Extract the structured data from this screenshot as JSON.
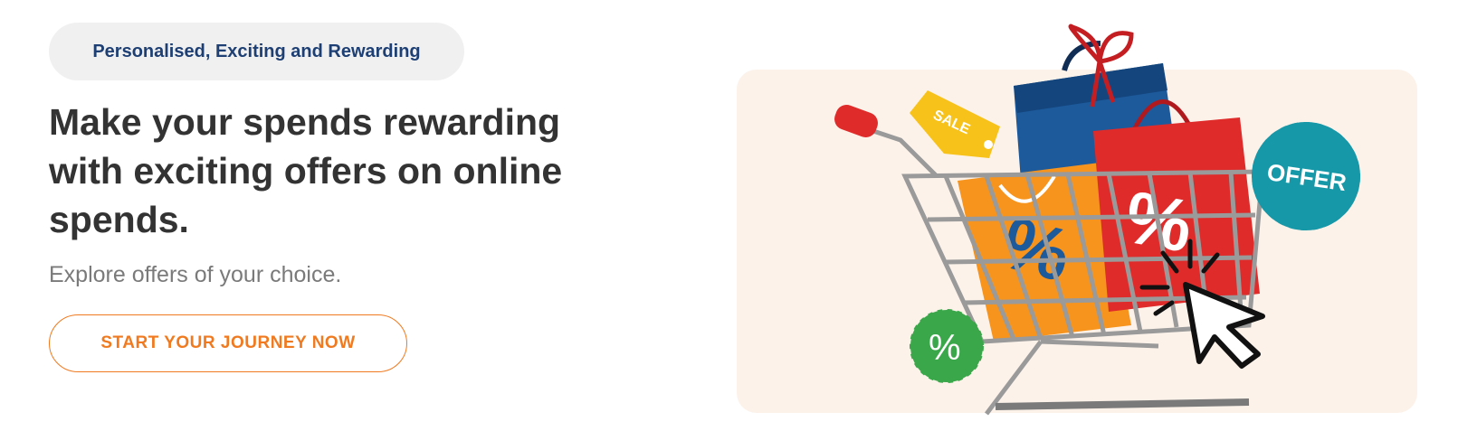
{
  "tagline": "Personalised, Exciting and Rewarding",
  "headline": "Make your spends rewarding with exciting offers on online spends.",
  "subtext": "Explore offers of your choice.",
  "cta_label": "START YOUR JOURNEY NOW",
  "illustration": {
    "sale_tag": "SALE",
    "offer_badge": "OFFER",
    "percent_badge": "%",
    "bag_percent": "%"
  },
  "colors": {
    "tagline_text": "#1d3f73",
    "headline_text": "#333333",
    "accent": "#f07a20",
    "hero_bg": "#fcf2ea",
    "offer_badge": "#1798a8",
    "percent_badge": "#3aa84a",
    "sale_tag": "#f7c21a"
  }
}
